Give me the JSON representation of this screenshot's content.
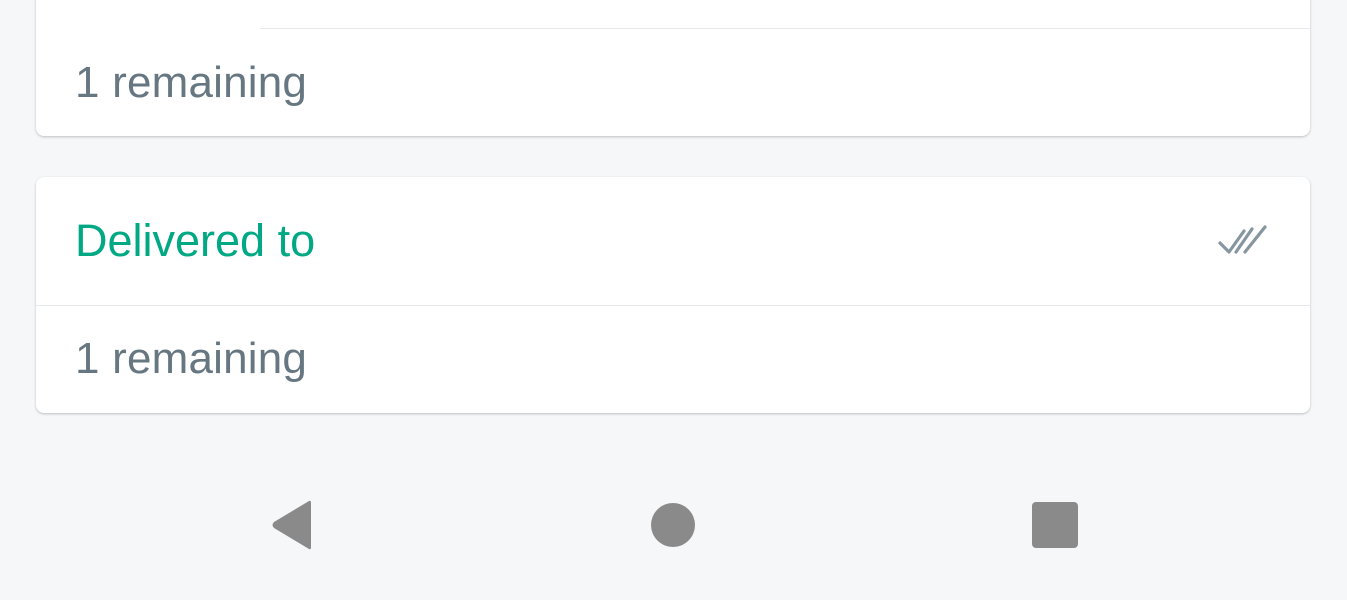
{
  "cards": [
    {
      "remaining": "1 remaining"
    },
    {
      "title": "Delivered to",
      "status_icon": "double-check-icon",
      "remaining": "1 remaining"
    }
  ],
  "colors": {
    "accent": "#00a884",
    "secondary_text": "#667781",
    "icon_gray": "#8696a0",
    "nav_gray": "#8a8a8a",
    "background": "#f6f7f9"
  },
  "navigation": {
    "back_icon": "back-triangle-icon",
    "home_icon": "home-circle-icon",
    "recents_icon": "recents-square-icon"
  }
}
